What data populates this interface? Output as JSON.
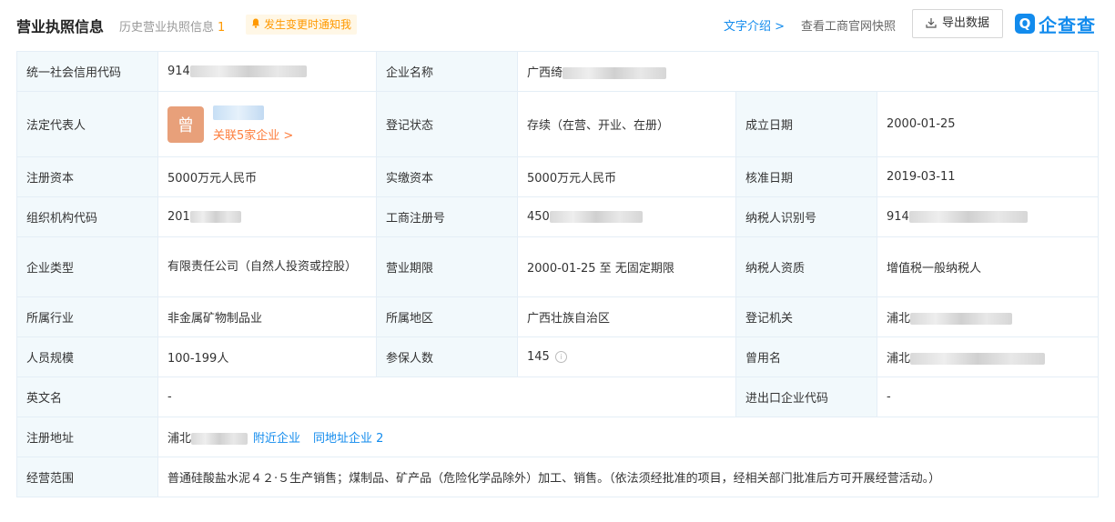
{
  "header": {
    "title": "营业执照信息",
    "history_label": "历史营业执照信息",
    "history_count": "1",
    "notify_label": "发生变更时通知我",
    "text_intro": "文字介绍 >",
    "snapshot": "查看工商官网快照",
    "export": "导出数据",
    "logo_mark": "Q",
    "logo_text": "企查查"
  },
  "rows": {
    "credit_code": {
      "label": "统一社会信用代码",
      "value": "914"
    },
    "company_name": {
      "label": "企业名称",
      "value": "广西绮"
    },
    "legal_rep": {
      "label": "法定代表人",
      "avatar": "曾",
      "related": "关联5家企业 >"
    },
    "reg_status": {
      "label": "登记状态",
      "value": "存续（在营、开业、在册）"
    },
    "founded": {
      "label": "成立日期",
      "value": "2000-01-25"
    },
    "reg_capital": {
      "label": "注册资本",
      "value": "5000万元人民币"
    },
    "paid_capital": {
      "label": "实缴资本",
      "value": "5000万元人民币"
    },
    "approved": {
      "label": "核准日期",
      "value": "2019-03-11"
    },
    "org_code": {
      "label": "组织机构代码",
      "value": "201"
    },
    "biz_reg_no": {
      "label": "工商注册号",
      "value": "450"
    },
    "taxpayer_id": {
      "label": "纳税人识别号",
      "value": "914"
    },
    "company_type": {
      "label": "企业类型",
      "value": "有限责任公司（自然人投资或控股）"
    },
    "biz_term": {
      "label": "营业期限",
      "value": "2000-01-25 至 无固定期限"
    },
    "taxpayer_qual": {
      "label": "纳税人资质",
      "value": "增值税一般纳税人"
    },
    "industry": {
      "label": "所属行业",
      "value": "非金属矿物制品业"
    },
    "region": {
      "label": "所属地区",
      "value": "广西壮族自治区"
    },
    "reg_authority": {
      "label": "登记机关",
      "value": "浦北"
    },
    "staff": {
      "label": "人员规模",
      "value": "100-199人"
    },
    "insured": {
      "label": "参保人数",
      "value": "145",
      "icon": "i"
    },
    "former_name": {
      "label": "曾用名",
      "value": "浦北"
    },
    "english_name": {
      "label": "英文名",
      "value": "-"
    },
    "import_export": {
      "label": "进出口企业代码",
      "value": "-"
    },
    "address": {
      "label": "注册地址",
      "value": "浦北",
      "nearby": "附近企业",
      "same_addr": "同地址企业 2"
    },
    "scope": {
      "label": "经营范围",
      "value": "普通硅酸盐水泥４２·５生产销售；煤制品、矿产品（危险化学品除外）加工、销售。（依法须经批准的项目，经相关部门批准后方可开展经营活动。）"
    }
  }
}
